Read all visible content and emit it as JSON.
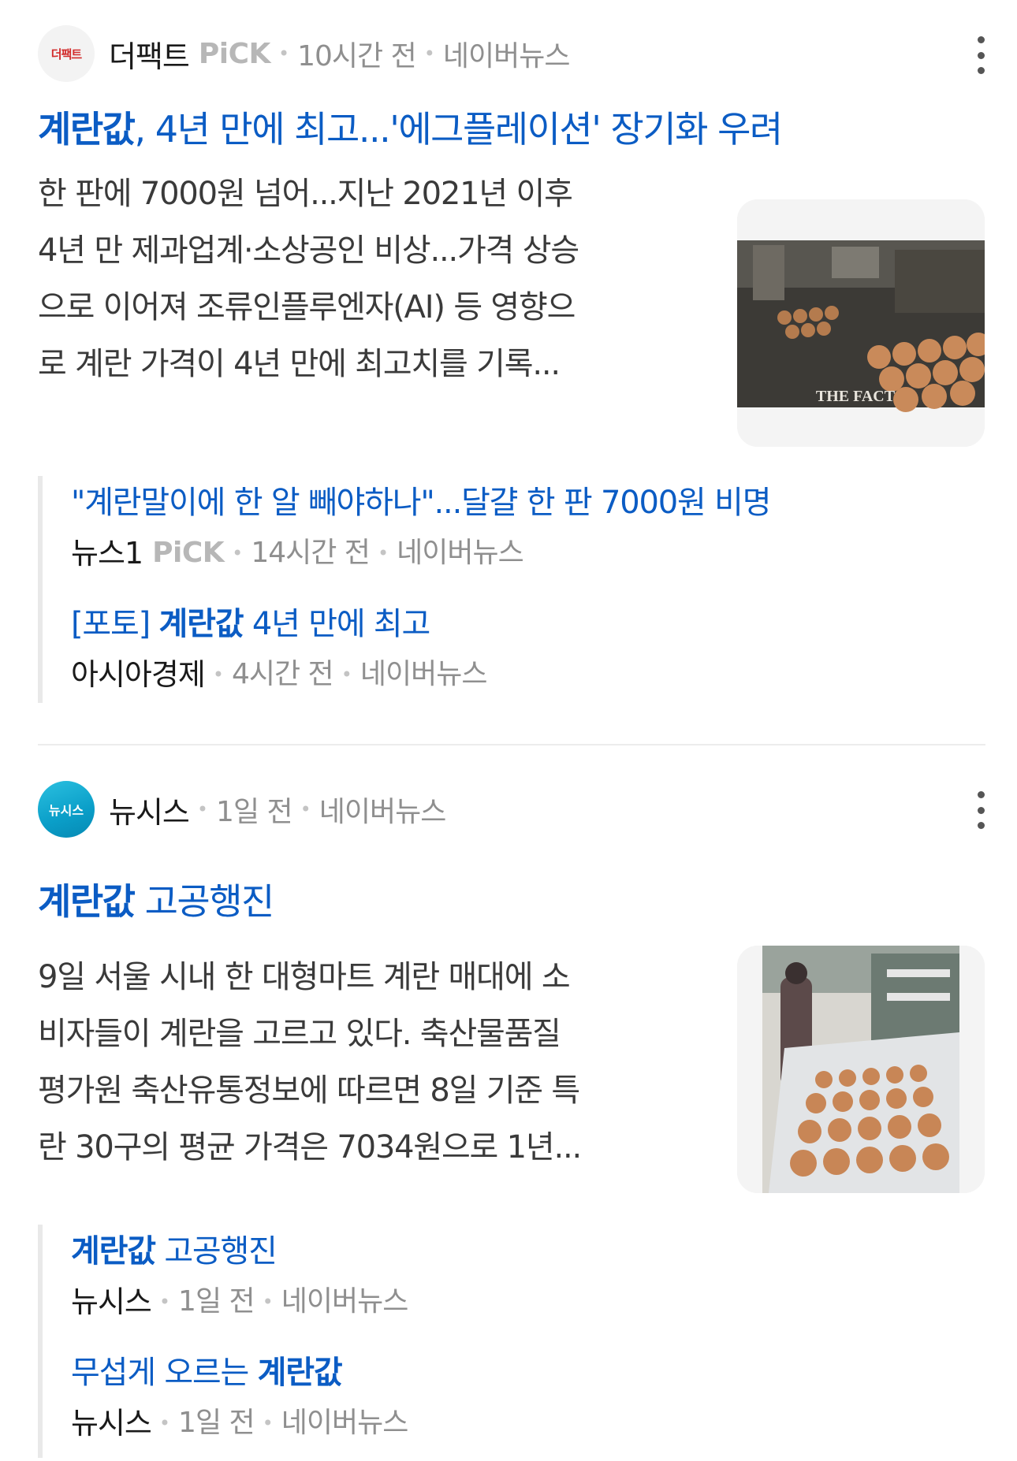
{
  "articles": [
    {
      "press": "더팩트",
      "logo_text": "더팩트",
      "pick": "PiCK",
      "time": "10시간 전",
      "platform": "네이버뉴스",
      "title_hl": "계란값",
      "title_rest": ", 4년 만에 최고...'에그플레이션' 장기화 우려",
      "desc_lines": [
        "한 판에 7000원 넘어...지난 2021년 이후",
        "4년 만 제과업계·소상공인 비상...가격 상승",
        "으로 이어져 조류인플루엔자(AI) 등 영향으",
        "로 계란 가격이 4년 만에 최고치를 기록..."
      ],
      "thumb_caption": "THE FACT",
      "related": [
        {
          "title_pre": "\"계란말이에 한 알 빼야하나\"...달걀 한 판 7000원 비명",
          "title_hl": "",
          "title_post": "",
          "press": "뉴스1",
          "pick": "PiCK",
          "time": "14시간 전",
          "platform": "네이버뉴스"
        },
        {
          "title_pre": "[포토] ",
          "title_hl": "계란값",
          "title_post": " 4년 만에 최고",
          "press": "아시아경제",
          "pick": "",
          "time": "4시간 전",
          "platform": "네이버뉴스"
        }
      ]
    },
    {
      "press": "뉴시스",
      "logo_text": "뉴시스",
      "pick": "",
      "time": "1일 전",
      "platform": "네이버뉴스",
      "title_hl": "계란값",
      "title_rest": " 고공행진",
      "desc_lines": [
        "9일 서울 시내 한 대형마트 계란 매대에 소",
        "비자들이 계란을 고르고 있다. 축산물품질",
        "평가원 축산유통정보에 따르면 8일 기준 특",
        "란 30구의 평균 가격은 7034원으로 1년..."
      ],
      "thumb_caption": "",
      "related": [
        {
          "title_pre": "",
          "title_hl": "계란값",
          "title_post": " 고공행진",
          "press": "뉴시스",
          "pick": "",
          "time": "1일 전",
          "platform": "네이버뉴스"
        },
        {
          "title_pre": "무섭게 오르는 ",
          "title_hl": "계란값",
          "title_post": "",
          "press": "뉴시스",
          "pick": "",
          "time": "1일 전",
          "platform": "네이버뉴스"
        }
      ]
    }
  ],
  "colors": {
    "link": "#0b5cc4",
    "meta": "#8f8f8f",
    "pick": "#b7b7b7"
  }
}
